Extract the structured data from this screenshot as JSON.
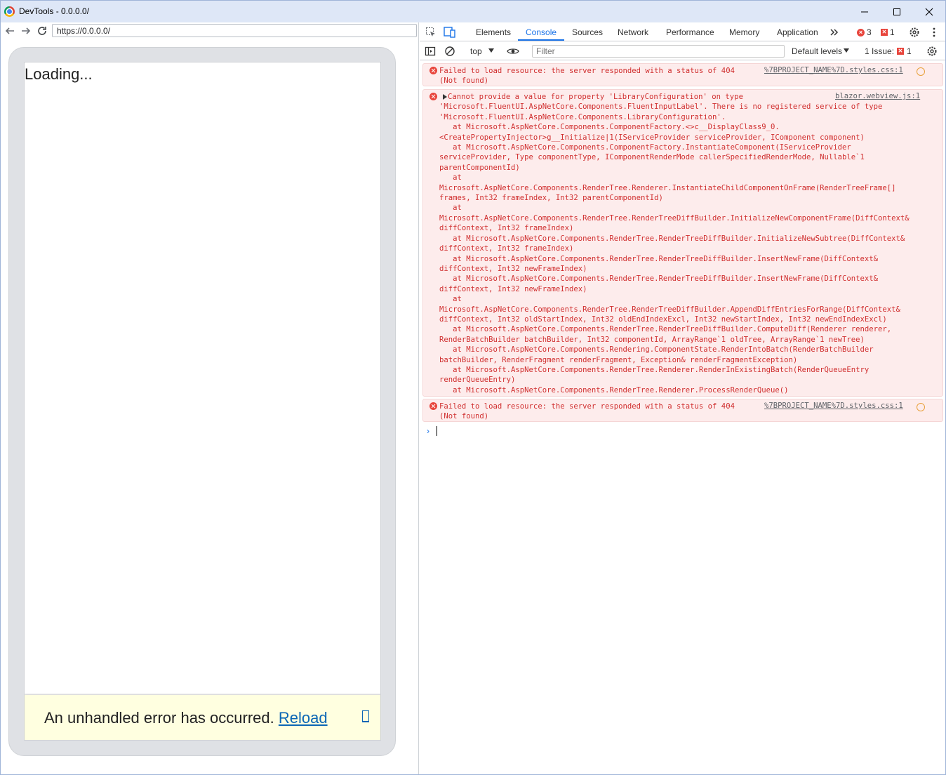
{
  "window": {
    "title": "DevTools - 0.0.0.0/"
  },
  "browser": {
    "url": "https://0.0.0.0/",
    "loading_text": "Loading...",
    "error_text": "An unhandled error has occurred.",
    "reload_label": "Reload"
  },
  "devtools": {
    "tabs": [
      "Elements",
      "Console",
      "Sources",
      "Network",
      "Performance",
      "Memory",
      "Application"
    ],
    "active_tab": "Console",
    "error_count": "3",
    "issue_count": "1",
    "context": "top",
    "filter_placeholder": "Filter",
    "levels_label": "Default levels",
    "issues_label": "1 Issue:",
    "issues_count": "1"
  },
  "console": {
    "messages": [
      {
        "text": "Failed to load resource: the server responded with a status of 404\n(Not found)",
        "source": "%7BPROJECT_NAME%7D.styles.css:1"
      },
      {
        "text": "Cannot provide a value for property 'LibraryConfiguration' on type\n'Microsoft.FluentUI.AspNetCore.Components.FluentInputLabel'. There is no registered service of type\n'Microsoft.FluentUI.AspNetCore.Components.LibraryConfiguration'.\n   at Microsoft.AspNetCore.Components.ComponentFactory.<>c__DisplayClass9_0.\n<CreatePropertyInjector>g__Initialize|1(IServiceProvider serviceProvider, IComponent component)\n   at Microsoft.AspNetCore.Components.ComponentFactory.InstantiateComponent(IServiceProvider\nserviceProvider, Type componentType, IComponentRenderMode callerSpecifiedRenderMode, Nullable`1\nparentComponentId)\n   at\nMicrosoft.AspNetCore.Components.RenderTree.Renderer.InstantiateChildComponentOnFrame(RenderTreeFrame[]\nframes, Int32 frameIndex, Int32 parentComponentId)\n   at\nMicrosoft.AspNetCore.Components.RenderTree.RenderTreeDiffBuilder.InitializeNewComponentFrame(DiffContext&\ndiffContext, Int32 frameIndex)\n   at Microsoft.AspNetCore.Components.RenderTree.RenderTreeDiffBuilder.InitializeNewSubtree(DiffContext&\ndiffContext, Int32 frameIndex)\n   at Microsoft.AspNetCore.Components.RenderTree.RenderTreeDiffBuilder.InsertNewFrame(DiffContext&\ndiffContext, Int32 newFrameIndex)\n   at Microsoft.AspNetCore.Components.RenderTree.RenderTreeDiffBuilder.InsertNewFrame(DiffContext&\ndiffContext, Int32 newFrameIndex)\n   at\nMicrosoft.AspNetCore.Components.RenderTree.RenderTreeDiffBuilder.AppendDiffEntriesForRange(DiffContext&\ndiffContext, Int32 oldStartIndex, Int32 oldEndIndexExcl, Int32 newStartIndex, Int32 newEndIndexExcl)\n   at Microsoft.AspNetCore.Components.RenderTree.RenderTreeDiffBuilder.ComputeDiff(Renderer renderer,\nRenderBatchBuilder batchBuilder, Int32 componentId, ArrayRange`1 oldTree, ArrayRange`1 newTree)\n   at Microsoft.AspNetCore.Components.Rendering.ComponentState.RenderIntoBatch(RenderBatchBuilder\nbatchBuilder, RenderFragment renderFragment, Exception& renderFragmentException)\n   at Microsoft.AspNetCore.Components.RenderTree.Renderer.RenderInExistingBatch(RenderQueueEntry\nrenderQueueEntry)\n   at Microsoft.AspNetCore.Components.RenderTree.Renderer.ProcessRenderQueue()",
        "source": "blazor.webview.js:1"
      },
      {
        "text": "Failed to load resource: the server responded with a status of 404\n(Not found)",
        "source": "%7BPROJECT_NAME%7D.styles.css:1"
      }
    ]
  }
}
